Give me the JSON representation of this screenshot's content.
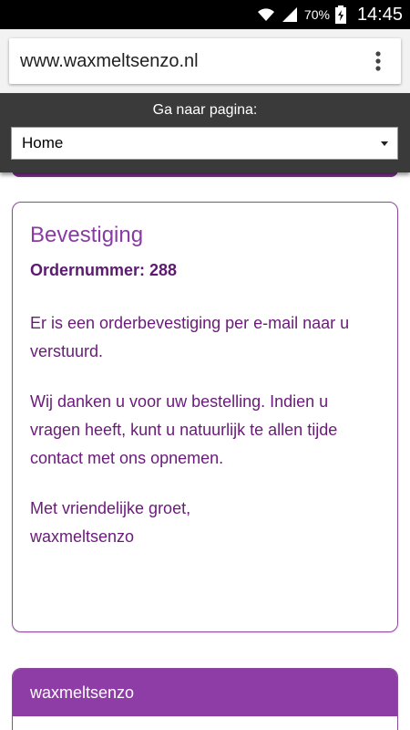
{
  "status_bar": {
    "battery": "70%",
    "time": "14:45",
    "icons": [
      "wifi-icon",
      "signal-icon",
      "battery-icon"
    ]
  },
  "browser": {
    "url": "www.waxmeltsenzo.nl",
    "menu_icon": "more-vert-icon"
  },
  "nav": {
    "label": "Ga naar pagina:",
    "selected": "Home"
  },
  "confirmation": {
    "title": "Bevestiging",
    "order_label": "Ordernummer: 288",
    "paragraph1": "Er is een orderbevestiging per e-mail naar u verstuurd.",
    "paragraph2": "Wij danken u voor uw bestelling. Indien u vragen heeft, kunt u natuurlijk te allen tijde contact met ons opnemen.",
    "greeting_line1": "Met vriendelijke groet,",
    "greeting_line2": "waxmeltsenzo"
  },
  "footer": {
    "title": "waxmeltsenzo"
  },
  "colors": {
    "brand_purple": "#8e3da6",
    "text_purple": "#6a1a7a",
    "nav_bg": "#3a3a3a"
  }
}
